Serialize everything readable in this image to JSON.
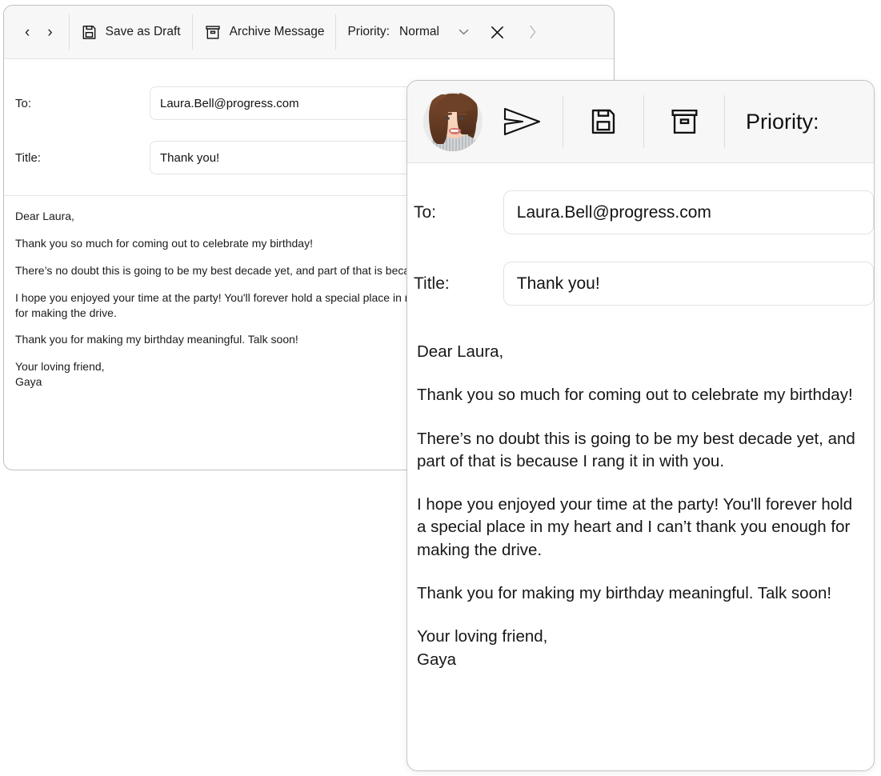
{
  "back_window": {
    "toolbar": {
      "nav_back": "‹",
      "nav_forward": "›",
      "save_draft_label": "Save as Draft",
      "archive_label": "Archive Message",
      "priority_label": "Priority:",
      "priority_value": "Normal",
      "dropdown_chevron": "⌄",
      "close_label": "✕",
      "overflow_chevron": "›"
    },
    "fields": {
      "to_label": "To:",
      "to_value": "Laura.Bell@progress.com",
      "title_label": "Title:",
      "title_value": "Thank you!"
    },
    "body_paragraphs": [
      "Dear Laura,",
      "Thank you so much for coming out to celebrate my birthday!",
      "There’s no doubt this is going to be my best decade yet, and part of that is because I rang it in with you.",
      "I hope you enjoyed your time at the party! You'll forever hold a special place in my heart and I can’t thank you enough for making the drive.",
      "Thank you for making my birthday meaningful. Talk soon!",
      "Your loving friend,\nGaya"
    ]
  },
  "front_window": {
    "toolbar": {
      "avatar_alt": "user-avatar",
      "send_icon": "send-icon",
      "save_icon": "save-icon",
      "archive_icon": "archive-icon",
      "priority_label": "Priority:"
    },
    "fields": {
      "to_label": "To:",
      "to_value": "Laura.Bell@progress.com",
      "title_label": "Title:",
      "title_value": "Thank you!"
    },
    "body_paragraphs": [
      "Dear Laura,",
      "Thank you so much for coming out to celebrate my birthday!",
      "There’s no doubt this is going to be my best decade yet, and part of that is because I rang it in with you.",
      "I hope you enjoyed your time at the party! You'll forever hold a special place in my heart and I can’t thank you enough for making the drive.",
      "Thank you for making my birthday meaningful. Talk soon!",
      "Your loving friend,\nGaya"
    ]
  },
  "colors": {
    "toolbar_bg": "#f7f7f7",
    "window_border": "#c4c4c4",
    "input_border": "#e1e1e1",
    "text": "#1a1a1a",
    "muted": "#9a9a9a"
  }
}
